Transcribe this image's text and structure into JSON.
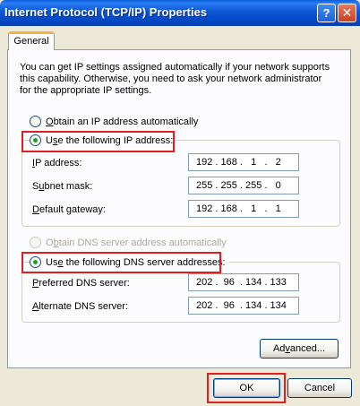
{
  "window": {
    "title": "Internet Protocol (TCP/IP) Properties",
    "help_glyph": "?",
    "close_glyph": "✕"
  },
  "tabs": [
    {
      "label": "General"
    }
  ],
  "description": "You can get IP settings assigned automatically if your network supports this capability. Otherwise, you need to ask your network administrator for the appropriate IP settings.",
  "ip_mode": {
    "auto_label_key": "O",
    "auto_label_rest": "btain an IP address automatically",
    "manual_label_key": "s",
    "manual_label_pre": "U",
    "manual_label_rest": "e the following IP address:",
    "selected": "manual"
  },
  "ip_fields": {
    "ip_label_key": "I",
    "ip_label_rest": "P address:",
    "ip_value": "192 . 168 .   1   .   2",
    "subnet_label_pre": "S",
    "subnet_label_key": "u",
    "subnet_label_rest": "bnet mask:",
    "subnet_value": "255 . 255 . 255 .   0",
    "gateway_label_key": "D",
    "gateway_label_rest": "efault gateway:",
    "gateway_value": "192 . 168 .   1   .   1"
  },
  "dns_mode": {
    "auto_label_pre": "O",
    "auto_label_key": "b",
    "auto_label_rest": "tain DNS server address automatically",
    "manual_label_pre": "Us",
    "manual_label_key": "e",
    "manual_label_rest": " the following DNS server addresses:",
    "selected": "manual"
  },
  "dns_fields": {
    "preferred_label_key": "P",
    "preferred_label_rest": "referred DNS server:",
    "preferred_value": "202 .  96  . 134 . 133",
    "alternate_label_key": "A",
    "alternate_label_rest": "lternate DNS server:",
    "alternate_value": "202 .  96  . 134 . 134"
  },
  "buttons": {
    "advanced_pre": "Ad",
    "advanced_key": "v",
    "advanced_rest": "anced...",
    "ok": "OK",
    "cancel": "Cancel"
  },
  "colors": {
    "highlight": "#e02020",
    "titlebar": "#0b56d4",
    "radio_selected": "#21a121"
  }
}
